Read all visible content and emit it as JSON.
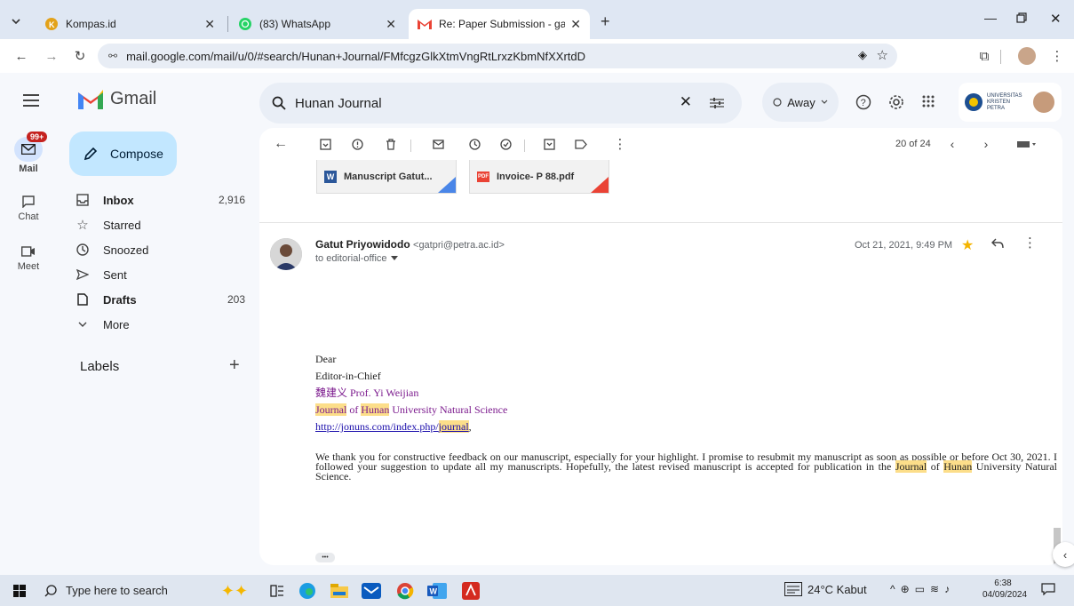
{
  "browser": {
    "tabs": [
      {
        "title": "Kompas.id",
        "active": false
      },
      {
        "title": "(83) WhatsApp",
        "active": false
      },
      {
        "title": "Re: Paper Submission - gatpri@",
        "active": true
      }
    ],
    "url": "mail.google.com/mail/u/0/#search/Hunan+Journal/FMfcgzGlkXtmVngRtLrxzKbmNfXXrtdD"
  },
  "gmail": {
    "logo_text": "Gmail",
    "rail": {
      "mail_badge": "99+",
      "mail": "Mail",
      "chat": "Chat",
      "meet": "Meet"
    },
    "compose": "Compose",
    "nav": [
      {
        "label": "Inbox",
        "count": "2,916",
        "bold": true
      },
      {
        "label": "Starred",
        "count": ""
      },
      {
        "label": "Snoozed",
        "count": ""
      },
      {
        "label": "Sent",
        "count": ""
      },
      {
        "label": "Drafts",
        "count": "203",
        "bold": true
      },
      {
        "label": "More",
        "count": ""
      }
    ],
    "labels_heading": "Labels",
    "search_query": "Hunan Journal",
    "status": "Away",
    "org_logo_text": "UNIVERSITAS KRISTEN PETRA",
    "pagination": "20 of 24"
  },
  "attachments": [
    {
      "name": "Manuscript Gatut...",
      "type": "W"
    },
    {
      "name": "Invoice- P 88.pdf",
      "type": "PDF"
    }
  ],
  "message": {
    "sender_name": "Gatut Priyowidodo",
    "sender_email": "<gatpri@petra.ac.id>",
    "to": "to editorial-office",
    "date": "Oct 21, 2021, 9:49 PM",
    "greeting": "Dear",
    "line_role": "Editor-in-Chief",
    "line_name": "魏建义 Prof. Yi Weijian",
    "line_journal_a": "Journal",
    "line_journal_b": " of ",
    "line_journal_c": "Hunan",
    "line_journal_d": " University Natural Science",
    "link_a": "http://jonuns.com/index.php/",
    "link_b": "journal",
    "link_c": ",",
    "para_1": "We thank you for constructive feedback on our manuscript, especially for your highlight.  I promise to resubmit my manuscript as soon as  possible or before  Oct 30, 2021. I followed your suggestion to update all my manuscripts.  Hopefully, the latest revised manuscript is accepted for publication in the ",
    "para_journal": "Journal",
    "para_of": " of ",
    "para_hunan": "Hunan",
    "para_end": " University Natural Science.",
    "ellipsis": "•••",
    "signature": "--"
  },
  "taskbar": {
    "search_placeholder": "Type here to search",
    "weather": "24°C  Kabut",
    "time": "6:38",
    "date": "04/09/2024"
  }
}
